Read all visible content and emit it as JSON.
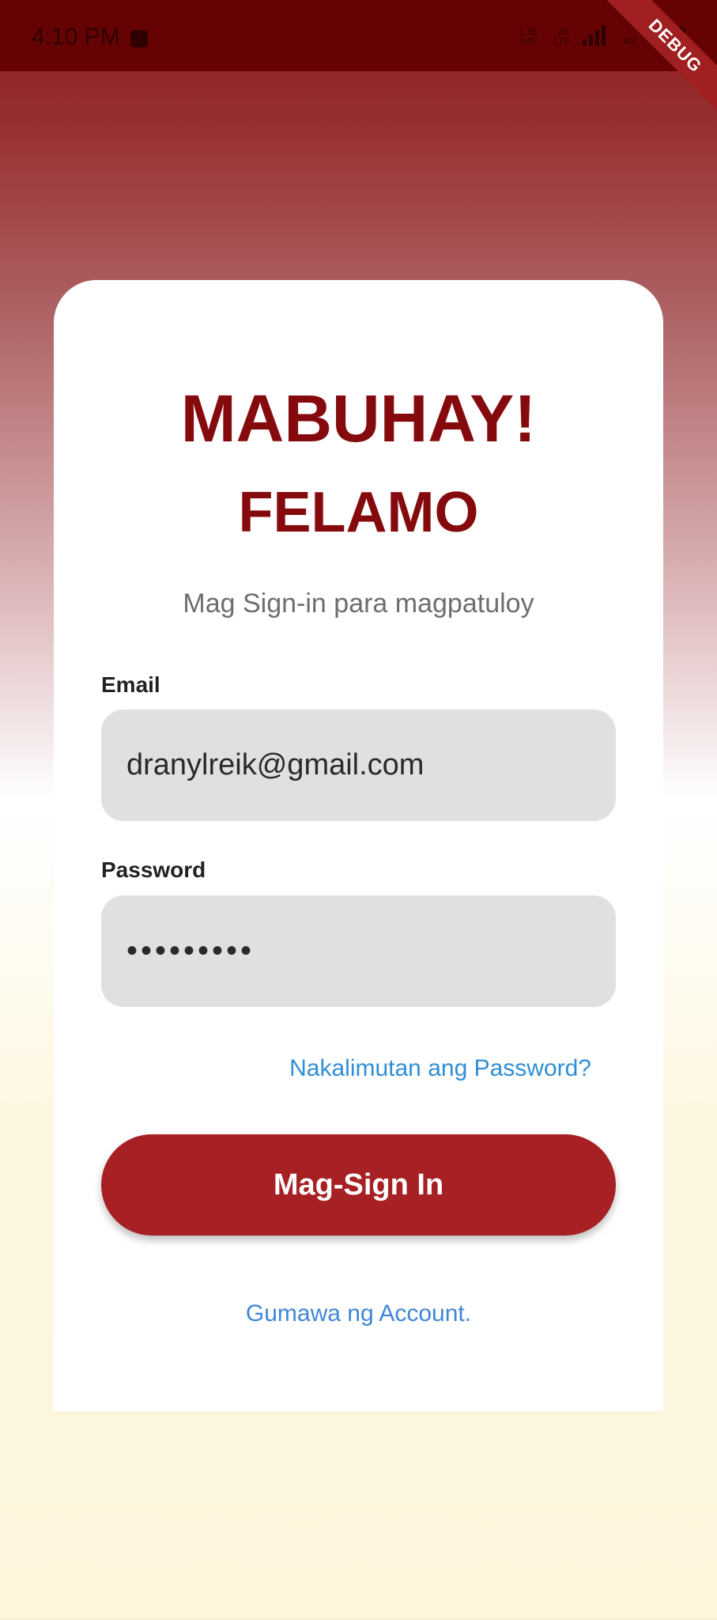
{
  "status_bar": {
    "time": "4:10 PM",
    "speed": "1.35\nK/S",
    "network_1": "Vo\nLTE",
    "network_2": "4G",
    "network_3": "4G",
    "debug_label": "DEBUG"
  },
  "login": {
    "title": "MABUHAY!",
    "app_name": "FELAMO",
    "subtitle": "Mag Sign-in para magpatuloy",
    "email_label": "Email",
    "email_value": "dranylreik@gmail.com",
    "password_label": "Password",
    "password_value": "•••••••••",
    "forgot_password": "Nakalimutan ang Password?",
    "signin_button": "Mag-Sign In",
    "create_account": "Gumawa ng Account."
  },
  "colors": {
    "primary": "#a62024",
    "title": "#850a0d",
    "link": "#2f8ed6"
  }
}
